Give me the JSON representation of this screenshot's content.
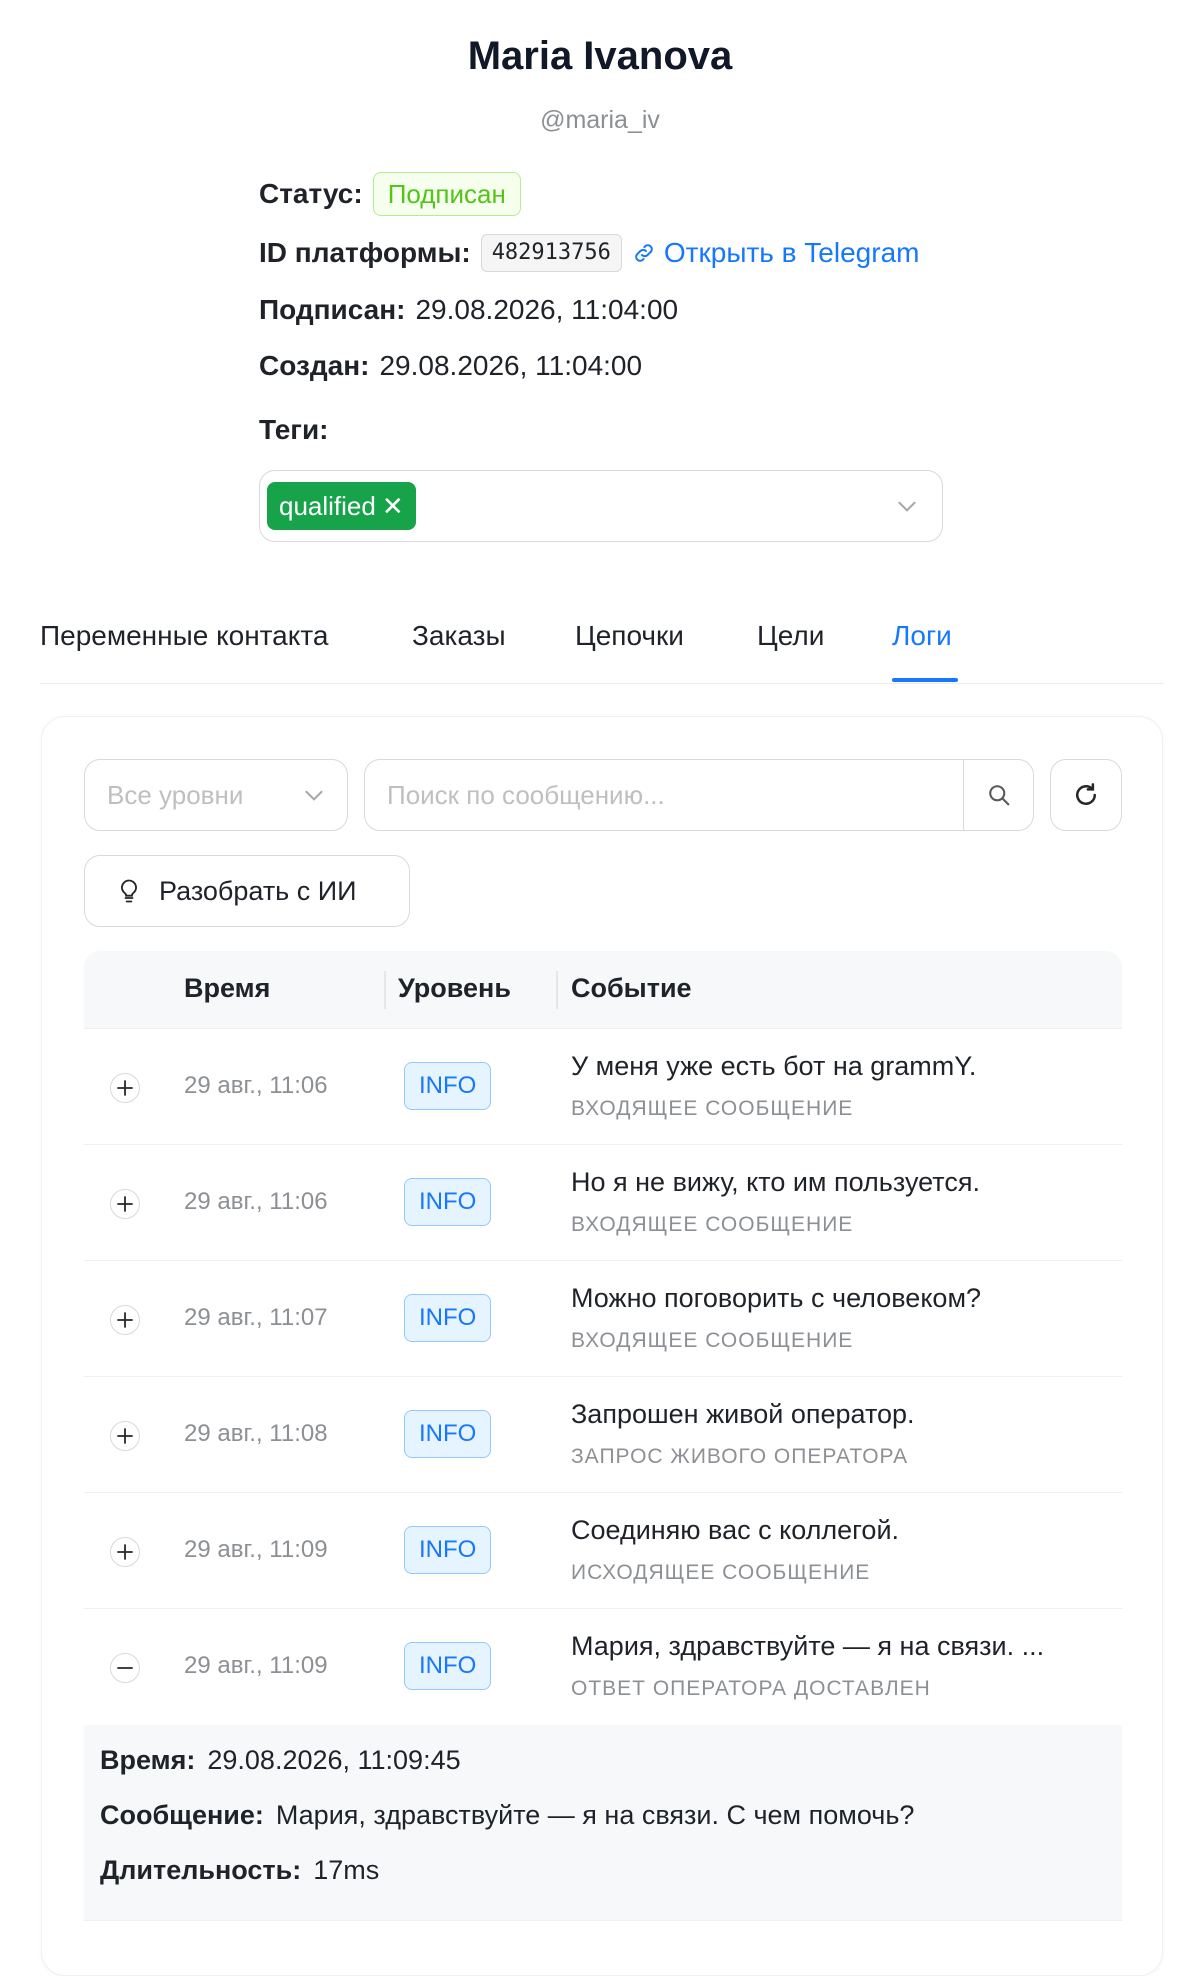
{
  "profile": {
    "name": "Maria Ivanova",
    "username": "@maria_iv",
    "status_label": "Статус:",
    "status_value": "Подписан",
    "platform_id_label": "ID платформы:",
    "platform_id_value": "482913756",
    "open_telegram": "Открыть в Telegram",
    "subscribed_label": "Подписан:",
    "subscribed_value": "29.08.2026, 11:04:00",
    "created_label": "Создан:",
    "created_value": "29.08.2026, 11:04:00",
    "tags_label": "Теги:",
    "tags": [
      "qualified"
    ]
  },
  "tabs": [
    {
      "label": "Переменные контакта",
      "active": false
    },
    {
      "label": "Заказы",
      "active": false
    },
    {
      "label": "Цепочки",
      "active": false
    },
    {
      "label": "Цели",
      "active": false
    },
    {
      "label": "Логи",
      "active": true
    }
  ],
  "logs": {
    "level_filter_placeholder": "Все уровни",
    "search_placeholder": "Поиск по сообщению...",
    "ai_button": "Разобрать с ИИ",
    "columns": {
      "time": "Время",
      "level": "Уровень",
      "event": "Событие"
    },
    "rows": [
      {
        "time": "29 авг., 11:06",
        "level": "INFO",
        "message": "У меня уже есть бот на grammY.",
        "type": "ВХОДЯЩЕЕ СООБЩЕНИЕ",
        "expanded": false
      },
      {
        "time": "29 авг., 11:06",
        "level": "INFO",
        "message": "Но я не вижу, кто им пользуется.",
        "type": "ВХОДЯЩЕЕ СООБЩЕНИЕ",
        "expanded": false
      },
      {
        "time": "29 авг., 11:07",
        "level": "INFO",
        "message": "Можно поговорить с человеком?",
        "type": "ВХОДЯЩЕЕ СООБЩЕНИЕ",
        "expanded": false
      },
      {
        "time": "29 авг., 11:08",
        "level": "INFO",
        "message": "Запрошен живой оператор.",
        "type": "ЗАПРОС ЖИВОГО ОПЕРАТОРА",
        "expanded": false
      },
      {
        "time": "29 авг., 11:09",
        "level": "INFO",
        "message": "Соединяю вас с коллегой.",
        "type": "ИСХОДЯЩЕЕ СООБЩЕНИЕ",
        "expanded": false
      },
      {
        "time": "29 авг., 11:09",
        "level": "INFO",
        "message": "Мария, здравствуйте — я на связи. ...",
        "type": "ОТВЕТ ОПЕРАТОРА ДОСТАВЛЕН",
        "expanded": true
      }
    ],
    "detail": {
      "time_label": "Время:",
      "time_value": "29.08.2026, 11:09:45",
      "message_label": "Сообщение:",
      "message_value": "Мария, здравствуйте — я на связи. С чем помочь?",
      "duration_label": "Длительность:",
      "duration_value": "17ms"
    }
  },
  "colors": {
    "accent": "#1677ff",
    "tag_green": "#16a34a",
    "status_green": "#52c41a"
  }
}
